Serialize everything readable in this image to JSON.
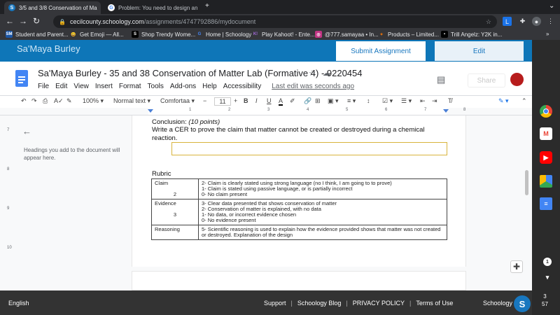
{
  "browser": {
    "tabs": [
      {
        "title": "3/5 and 3/8 Conservation of Ma",
        "favicon": "S",
        "active": true
      },
      {
        "title": "Problem: You need to design an",
        "favicon": "G",
        "active": false
      }
    ],
    "new_tab": "+",
    "url_host": "cecilcounty.schoology.com",
    "url_path": "/assignments/4747792886/mydocument",
    "bookmarks": [
      {
        "label": "Student and Parent...",
        "icon": "SM"
      },
      {
        "label": "Get Emoji — All...",
        "icon": "😀"
      },
      {
        "label": "Shop Trendy Wome...",
        "icon": "S"
      },
      {
        "label": "Home | Schoology",
        "icon": "G"
      },
      {
        "label": "Play Kahoot! - Ente...",
        "icon": "K!"
      },
      {
        "label": "@777.samayaa • In...",
        "icon": "◎"
      },
      {
        "label": "Products – Limited...",
        "icon": "✦"
      },
      {
        "label": "Trill Angelz: Y2K in...",
        "icon": "▪"
      }
    ],
    "bookmarks_more": "»"
  },
  "schoology": {
    "student_name": "Sa'Maya Burley",
    "submit_label": "Submit Assignment",
    "edit_label": "Edit"
  },
  "docs": {
    "title": "Sa'Maya Burley - 35 and 38 Conservation of Matter Lab (Formative 4) - 9220454",
    "menu": [
      "File",
      "Edit",
      "View",
      "Insert",
      "Format",
      "Tools",
      "Add-ons",
      "Help",
      "Accessibility"
    ],
    "last_edit": "Last edit was seconds ago",
    "share_label": "Share",
    "toolbar": {
      "zoom": "100%",
      "style": "Normal text",
      "font": "Comfortaa",
      "font_size": "11",
      "bold": "B",
      "italic": "I",
      "underline": "U",
      "text_color": "A"
    },
    "ruler_numbers": [
      "1",
      "2",
      "3",
      "4",
      "5",
      "6",
      "7",
      "8"
    ],
    "vruler_numbers": [
      "7",
      "8",
      "9",
      "10"
    ],
    "outline_hint": "Headings you add to the document will appear here."
  },
  "document": {
    "conclusion_label": "Conclusion:",
    "conclusion_points": "(10 points)",
    "cer_prompt": "Write a CER to prove the claim that matter cannot be created or destroyed during a chemical reaction.",
    "rubric_label": "Rubric",
    "rubric": [
      {
        "criterion": "Claim",
        "score": "2",
        "lines": [
          "2- Claim is clearly stated using strong language (no I think, I am going to to prove)",
          "1- Claim is stated using passive language, or is partially incorrect",
          "0- No claim present"
        ]
      },
      {
        "criterion": "Evidence",
        "score": "3",
        "lines": [
          "3- Clear data presented that shows conservation of matter",
          "2- Conservation of matter is explained, with no data",
          "1- No data, or incorrect evidence chosen",
          "0- No evidence present"
        ]
      },
      {
        "criterion": "Reasoning",
        "score": "",
        "lines": [
          "5- Scientific reasoning is used to explain how the evidence provided shows that matter was not created or destroyed. Explanation of the design"
        ]
      }
    ]
  },
  "footer": {
    "language": "English",
    "links": [
      "Support",
      "Schoology Blog",
      "PRIVACY POLICY",
      "Terms of Use"
    ],
    "brand": "Schoology",
    "logo_letter": "S"
  },
  "shelf": {
    "notification_count": "1",
    "time_hour": "3",
    "time_minute": "57"
  },
  "colors": {
    "schoology_blue": "#0e76b8",
    "docs_blue": "#4285f4",
    "answer_box_border": "#d8b43c",
    "footer_bg": "#333333"
  }
}
